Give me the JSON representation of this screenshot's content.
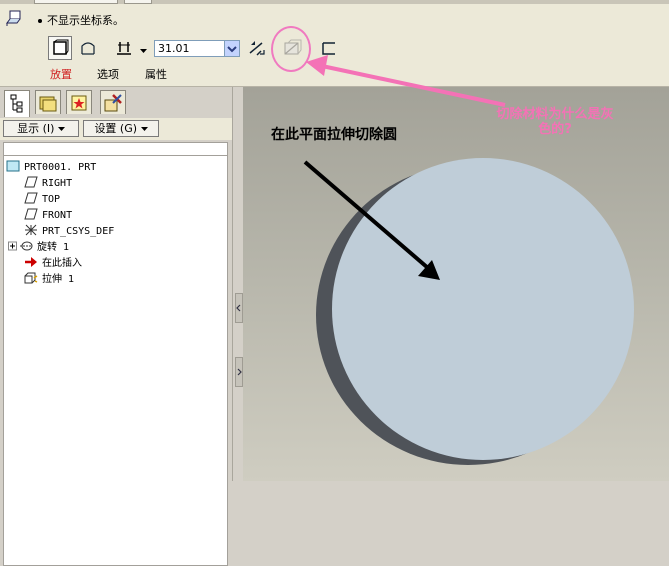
{
  "dashboard": {
    "option_text": "不显示坐标系。",
    "depth_value": "31.01",
    "tabs": [
      "放置",
      "选项",
      "属性"
    ]
  },
  "tree_toolbar": {
    "show_menu": "显示 (I)",
    "settings_menu": "设置 (G)"
  },
  "model_tree": {
    "items": [
      {
        "label": "PRT0001. PRT",
        "icon": "part-icon"
      },
      {
        "label": "RIGHT",
        "icon": "datum-plane-icon"
      },
      {
        "label": "TOP",
        "icon": "datum-plane-icon"
      },
      {
        "label": "FRONT",
        "icon": "datum-plane-icon"
      },
      {
        "label": "PRT_CSYS_DEF",
        "icon": "csys-icon"
      },
      {
        "label": "旋转 1",
        "icon": "revolve-icon"
      },
      {
        "label": "在此插入",
        "icon": "insert-here-arrow-icon"
      },
      {
        "label": "拉伸 1",
        "icon": "extrude-icon"
      }
    ]
  },
  "annotations": {
    "sketch_plane_note": "在此平面拉伸切除圆",
    "question_note": "切除材料为什么是灰色的?"
  },
  "colors": {
    "dashboard_bg": "#ece9d8",
    "tab_active": "#d02020",
    "annotation_pink": "#f472b6",
    "model_face": "#bfcdd8",
    "model_edge": "#4f5359"
  }
}
